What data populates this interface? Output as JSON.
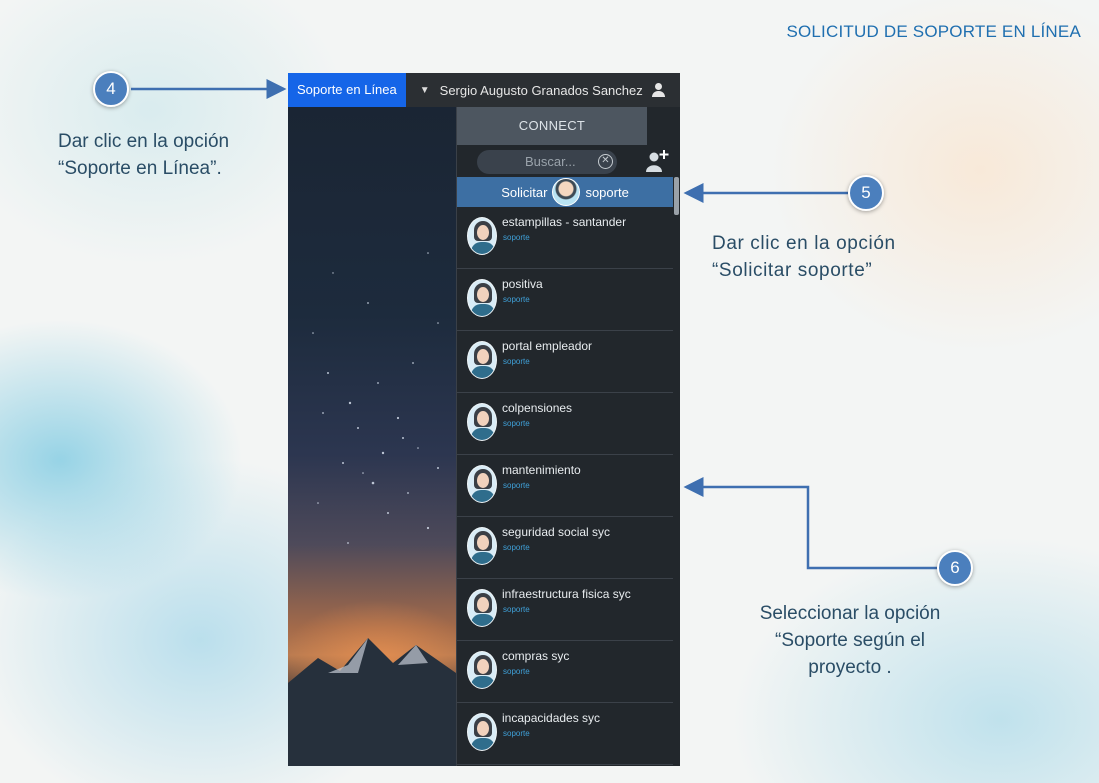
{
  "slide": {
    "title": "SOLICITUD DE SOPORTE EN LÍNEA",
    "step4": {
      "number": "4",
      "caption_line1": "Dar clic en la opción",
      "caption_line2": "“Soporte en Línea”."
    },
    "step5": {
      "number": "5",
      "caption_line1": "Dar clic en la opción",
      "caption_line2": "“Solicitar soporte”"
    },
    "step6": {
      "number": "6",
      "caption_line1": "Seleccionar la opción",
      "caption_line2": "“Soporte según el",
      "caption_line3": "proyecto ."
    },
    "colors": {
      "accent": "#1f6fb0",
      "step_circle": "#4b7fbd"
    }
  },
  "app": {
    "topbar": {
      "support_button": "Soporte en Línea",
      "user_name": "Sergio Augusto Granados Sanchez",
      "user_icon": "user-icon",
      "caret_icon": "caret-down-icon"
    },
    "panel": {
      "header": "CONNECT",
      "search": {
        "placeholder": "Buscar..."
      },
      "request_support": {
        "left": "Solicitar",
        "right": "soporte"
      },
      "contacts": [
        {
          "name": "estampillas - santander",
          "status": "soporte"
        },
        {
          "name": "positiva",
          "status": "soporte"
        },
        {
          "name": "portal empleador",
          "status": "soporte"
        },
        {
          "name": "colpensiones",
          "status": "soporte"
        },
        {
          "name": "mantenimiento",
          "status": "soporte"
        },
        {
          "name": "seguridad social syc",
          "status": "soporte"
        },
        {
          "name": "infraestructura fisica syc",
          "status": "soporte"
        },
        {
          "name": "compras syc",
          "status": "soporte"
        },
        {
          "name": "incapacidades syc",
          "status": "soporte"
        }
      ]
    },
    "colors": {
      "button_blue": "#1565e8",
      "request_row": "#3d6fa3",
      "status_text": "#3fa0d8"
    }
  }
}
